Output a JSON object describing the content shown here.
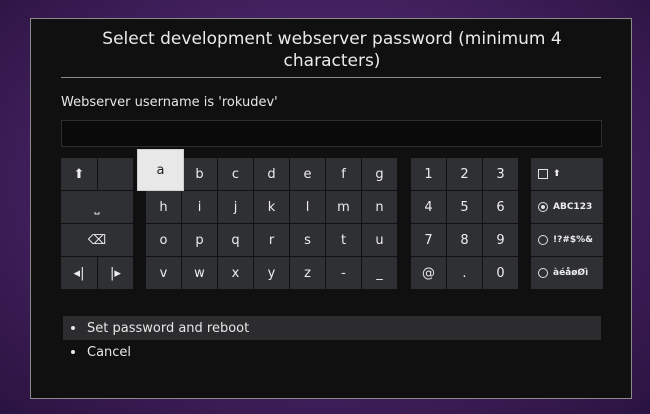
{
  "dialog": {
    "title": "Select development webserver password (minimum 4 characters)",
    "username_label": "Webserver username is 'rokudev'",
    "password_value": ""
  },
  "keyboard": {
    "function_keys": [
      {
        "name": "shift-key",
        "icon": "shift-arrow-icon",
        "glyph": "⬆"
      },
      {
        "name": "space-key",
        "icon": "space-bar-icon",
        "glyph": "⎵"
      },
      {
        "name": "backspace-key",
        "icon": "backspace-icon",
        "glyph": "⌫"
      },
      {
        "name": "cursor-left-key",
        "icon": "cursor-left-icon",
        "glyph": "◂|"
      },
      {
        "name": "cursor-right-key",
        "icon": "cursor-right-icon",
        "glyph": "|▸"
      }
    ],
    "letters": [
      "a",
      "b",
      "c",
      "d",
      "e",
      "f",
      "g",
      "h",
      "i",
      "j",
      "k",
      "l",
      "m",
      "n",
      "o",
      "p",
      "q",
      "r",
      "s",
      "t",
      "u",
      "v",
      "w",
      "x",
      "y",
      "z",
      "-",
      "_"
    ],
    "selected_key": "a",
    "numbers": [
      "1",
      "2",
      "3",
      "4",
      "5",
      "6",
      "7",
      "8",
      "9",
      "@",
      ".",
      "0"
    ],
    "modes": {
      "caps_label": "⬆",
      "abc_label": "ABC123",
      "symbols_label": "!?#$%&",
      "accents_label": "àéåøØì",
      "active_mode": "ABC123"
    }
  },
  "menu": {
    "items": [
      "Set password and reboot",
      "Cancel"
    ],
    "active_item": "Set password and reboot"
  }
}
